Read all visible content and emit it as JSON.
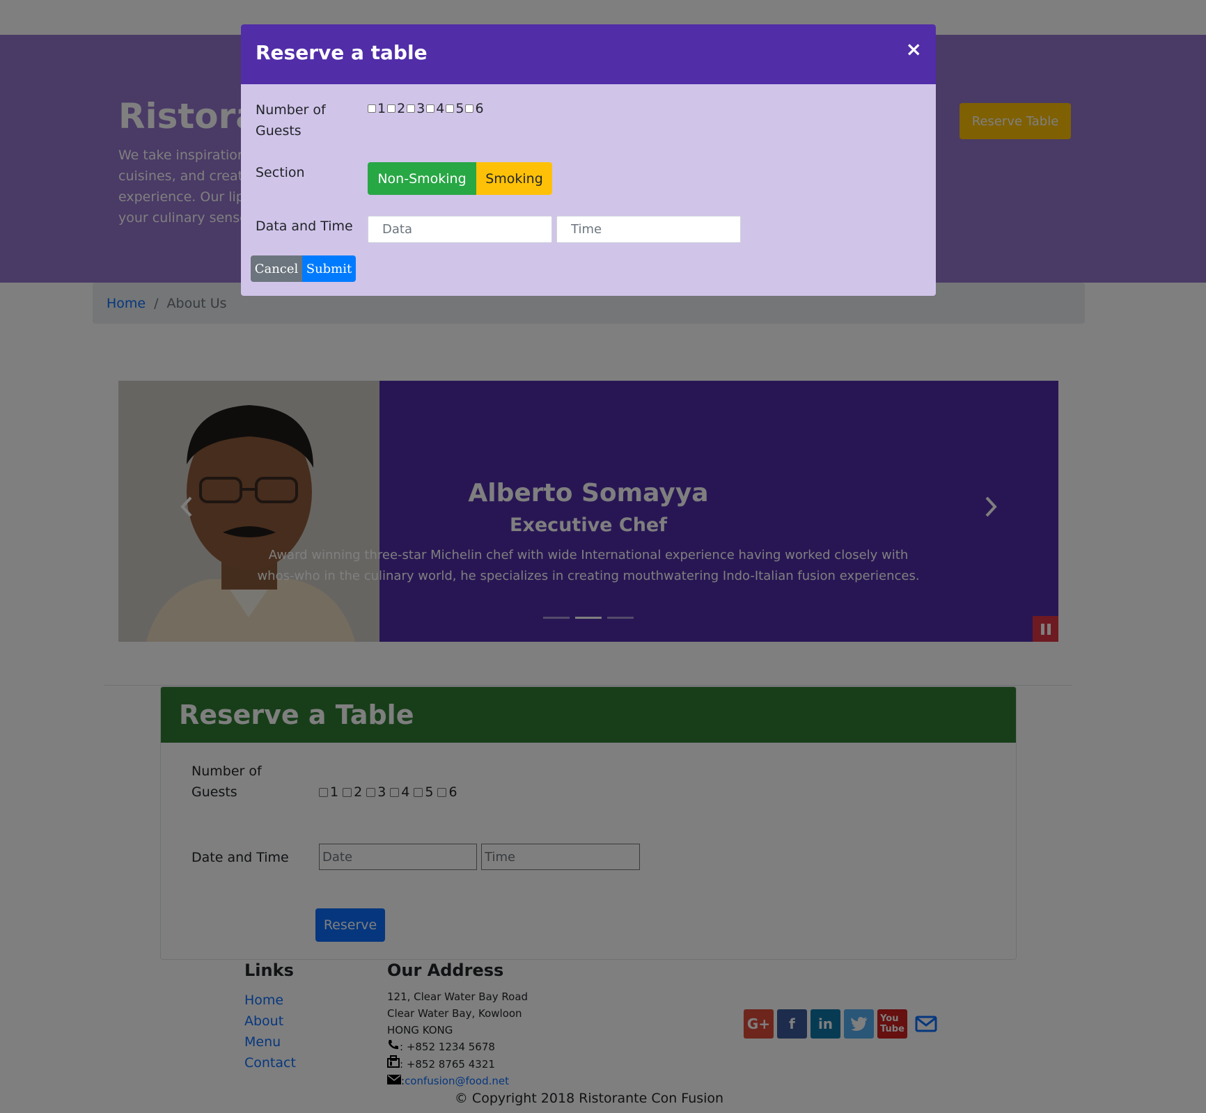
{
  "navbar": {},
  "jumbotron": {
    "title": "Ristorante Con Fusion",
    "text": "We take inspiration from the World's best cuisines, and create a unique fusion experience. Our lipsmacking creations will tickle your culinary senses!",
    "reserve_button": "Reserve Table"
  },
  "breadcrumb": {
    "home": "Home",
    "separator": "/",
    "current": "About Us"
  },
  "carousel": {
    "name": "Alberto Somayya",
    "role": "Executive Chef",
    "description": "Award winning three-star Michelin chef with wide International experience having worked closely with whos-who in the culinary world, he specializes in creating mouthwatering Indo-Italian fusion experiences.",
    "prev_icon": "chevron-left-icon",
    "next_icon": "chevron-right-icon",
    "pause_icon": "pause-icon",
    "indicators": 3,
    "active_indicator": 2
  },
  "reserve_card": {
    "title": "Reserve a Table",
    "guests_label_line1": "Number of",
    "guests_label_line2": "Guests",
    "guest_options": [
      "1",
      "2",
      "3",
      "4",
      "5",
      "6"
    ],
    "datetime_label": "Date and Time",
    "date_placeholder": "Date",
    "time_placeholder": "Time",
    "reserve_button": "Reserve"
  },
  "footer": {
    "links_title": "Links",
    "links": [
      "Home",
      "About",
      "Menu",
      "Contact"
    ],
    "address_title": "Our Address",
    "address_lines": [
      "121, Clear Water Bay Road",
      "Clear Water Bay, Kowloon",
      "HONG KONG"
    ],
    "phone": ": +852 1234 5678",
    "fax": ": +852 8765 4321",
    "email_prefix": ":",
    "email": "confusion@food.net",
    "socials": [
      "google-plus-icon",
      "facebook-icon",
      "linkedin-icon",
      "twitter-icon",
      "youtube-icon",
      "envelope-icon"
    ],
    "copyright": "© Copyright 2018 Ristorante Con Fusion"
  },
  "modal": {
    "title": "Reserve a table",
    "close": "×",
    "guests_label_line1": "Number of",
    "guests_label_line2": "Guests",
    "guest_options": [
      "1",
      "2",
      "3",
      "4",
      "5",
      "6"
    ],
    "section_label": "Section",
    "non_smoking": "Non-Smoking",
    "smoking": "Smoking",
    "datetime_label": "Data and Time",
    "date_placeholder": "Data",
    "time_placeholder": "Time",
    "cancel": "Cancel",
    "submit": "Submit"
  },
  "colors": {
    "primary_dark": "#512da8",
    "primary": "#9575cd",
    "primary_light": "#d1c4e9",
    "success": "#28a745",
    "warning": "#ffc107",
    "link": "#0d6efd"
  }
}
